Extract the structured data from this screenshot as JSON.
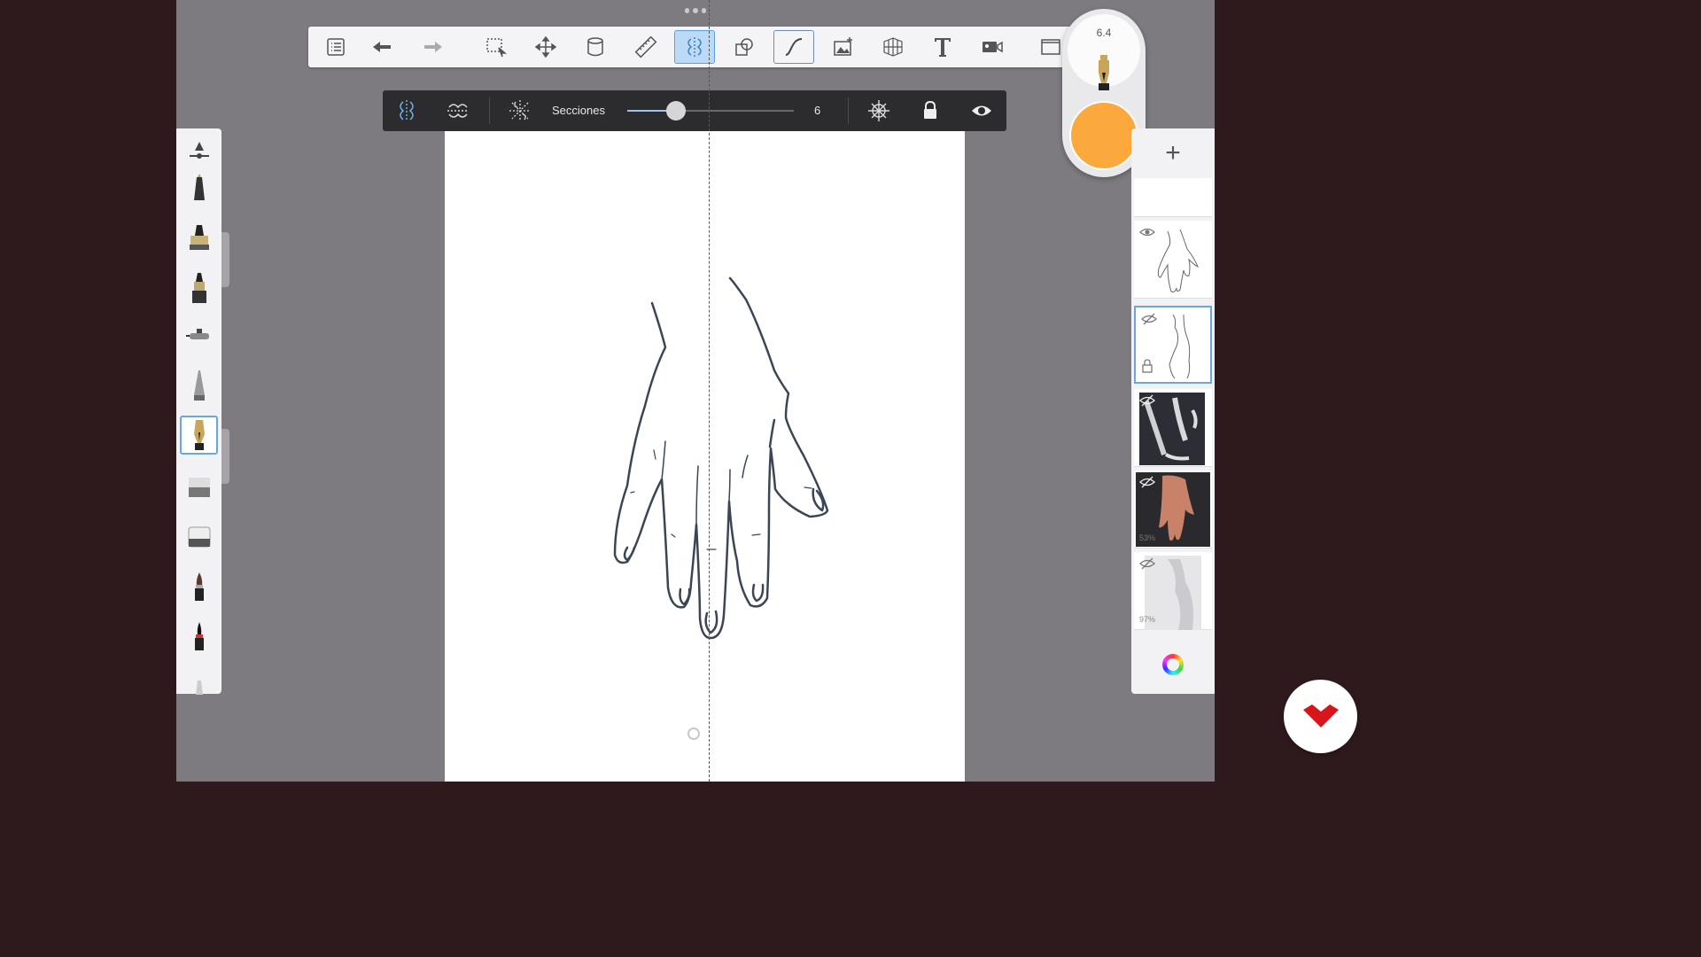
{
  "toolbar": {
    "items": [
      {
        "name": "layers-list-icon"
      },
      {
        "name": "undo-icon"
      },
      {
        "name": "redo-icon"
      },
      {
        "name": "selection-icon"
      },
      {
        "name": "transform-icon"
      },
      {
        "name": "fill-icon"
      },
      {
        "name": "ruler-icon"
      },
      {
        "name": "symmetry-icon",
        "active": true
      },
      {
        "name": "shapes-icon"
      },
      {
        "name": "predictive-stroke-icon",
        "outlined": true
      },
      {
        "name": "image-import-icon"
      },
      {
        "name": "perspective-icon"
      },
      {
        "name": "text-icon"
      },
      {
        "name": "record-icon"
      },
      {
        "name": "fullscreen-icon"
      }
    ]
  },
  "brush_puck": {
    "size": "6.4",
    "color": "#fba83c"
  },
  "symmetry_bar": {
    "label": "Secciones",
    "sections_value": "6",
    "slider_fraction": 0.29
  },
  "brushes": {
    "items": [
      "pencil",
      "marker",
      "ink-pen",
      "airbrush",
      "fineliner",
      "fountain-pen",
      "eraser-hard",
      "eraser-soft",
      "paint-brush",
      "ink-brush",
      "smudge"
    ],
    "selected_index": 5
  },
  "layers": {
    "items": [
      {
        "name": "hand-line-layer",
        "visible": true,
        "opacity": ""
      },
      {
        "name": "hand-sketch-layer",
        "visible": false,
        "selected": true,
        "opacity": ""
      },
      {
        "name": "reference-photo-arms",
        "visible": false,
        "opacity": ""
      },
      {
        "name": "reference-photo-hand",
        "visible": false,
        "opacity": "53%"
      },
      {
        "name": "reference-photo-torso",
        "visible": false,
        "opacity": "97%"
      }
    ]
  },
  "colors": {
    "accent": "#5d9fdc",
    "app_bg": "#7d7b80",
    "bar_bg": "#2c2c2e",
    "stroke": "#3a4555",
    "logo": "#d8151b"
  }
}
